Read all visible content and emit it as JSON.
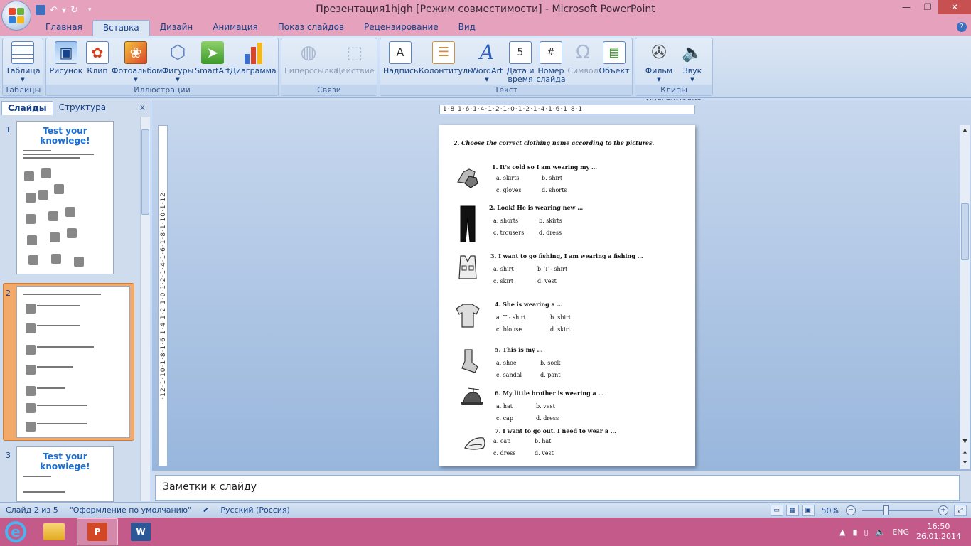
{
  "window": {
    "title": "Презентация1hjgh [Режим совместимости] - Microsoft PowerPoint"
  },
  "tabs": [
    "Главная",
    "Вставка",
    "Дизайн",
    "Анимация",
    "Показ слайдов",
    "Рецензирование",
    "Вид"
  ],
  "active_tab": "Вставка",
  "ribbon": {
    "tables": {
      "label": "Таблицы",
      "table_btn": "Таблица"
    },
    "illustrations": {
      "label": "Иллюстрации",
      "picture": "Рисунок",
      "clip": "Клип",
      "photoalbum": "Фотоальбом",
      "shapes": "Фигуры",
      "smartart": "SmartArt",
      "chart": "Диаграмма"
    },
    "links": {
      "label": "Связи",
      "hyperlink": "Гиперссылка",
      "action": "Действие"
    },
    "text": {
      "label": "Текст",
      "textbox": "Надпись",
      "headerfooter": "Колонтитулы",
      "wordart": "WordArt",
      "datetime_1": "Дата и",
      "datetime_2": "время",
      "slidenum_1": "Номер",
      "slidenum_2": "слайда",
      "symbol": "Символ",
      "object": "Объект"
    },
    "media": {
      "label": "Клипы мультимедиа",
      "movie": "Фильм",
      "sound": "Звук"
    }
  },
  "left_pane": {
    "tab_slides": "Слайды",
    "tab_outline": "Структура",
    "thumb1_num": "1",
    "thumb2_num": "2",
    "thumb3_num": "3",
    "thumb1_title": "Test your knowlege!",
    "thumb3_title": "Test your knowlege!"
  },
  "rulers": {
    "h": "·1·8·1·6·1·4·1·2·1·0·1·2·1·4·1·6·1·8·1",
    "v": "·12·1·10·1·8·1·6·1·4·1·2·1·0·1·2·1·4·1·6·1·8·1·10·1·12·"
  },
  "slide": {
    "heading": "2. Choose the correct clothing name according to the pictures.",
    "questions": [
      {
        "text": "1. It's cold so I am wearing my …",
        "a": "a.     skirts",
        "b": "b.   shirt",
        "c": "c.    gloves",
        "d": "d.    shorts"
      },
      {
        "text": "2. Look! He is wearing new …",
        "a": "a.     shorts",
        "b": "b.   skirts",
        "c": "c.    trousers",
        "d": "d.    dress"
      },
      {
        "text": "3. I want to go fishing, I am wearing a fishing …",
        "a": "a.     shirt",
        "b": "b.   T - shirt",
        "c": "c.    skirt",
        "d": "d.    vest"
      },
      {
        "text": "4. She is wearing a …",
        "a": "a.     T - shirt",
        "b": "b.   shirt",
        "c": "c.    blouse",
        "d": "d.    skirt"
      },
      {
        "text": "5. This is my …",
        "a": "a.     shoe",
        "b": "b.   sock",
        "c": "c.    sandal",
        "d": "d.    pant"
      },
      {
        "text": "6. My little brother is wearing a …",
        "a": "a.     hat",
        "b": "b.   vest",
        "c": "c.    cap",
        "d": "d.    dress"
      },
      {
        "text": "7. I want to go out. I need to wear a …",
        "a": "a.    cap",
        "b": "b.   hat",
        "c": "c.    dress",
        "d": "d.    vest"
      }
    ]
  },
  "notes": {
    "placeholder": "Заметки к слайду"
  },
  "status": {
    "slide_of": "Слайд 2 из 5",
    "theme": "\"Оформление по умолчанию\"",
    "language": "Русский (Россия)",
    "zoom": "50%"
  },
  "tray": {
    "lang": "ENG",
    "time": "16:50",
    "date": "26.01.2014"
  },
  "colors": {
    "titlebar": "#e6a2bd",
    "taskbar": "#c45a8a",
    "accent": "#15428b"
  }
}
